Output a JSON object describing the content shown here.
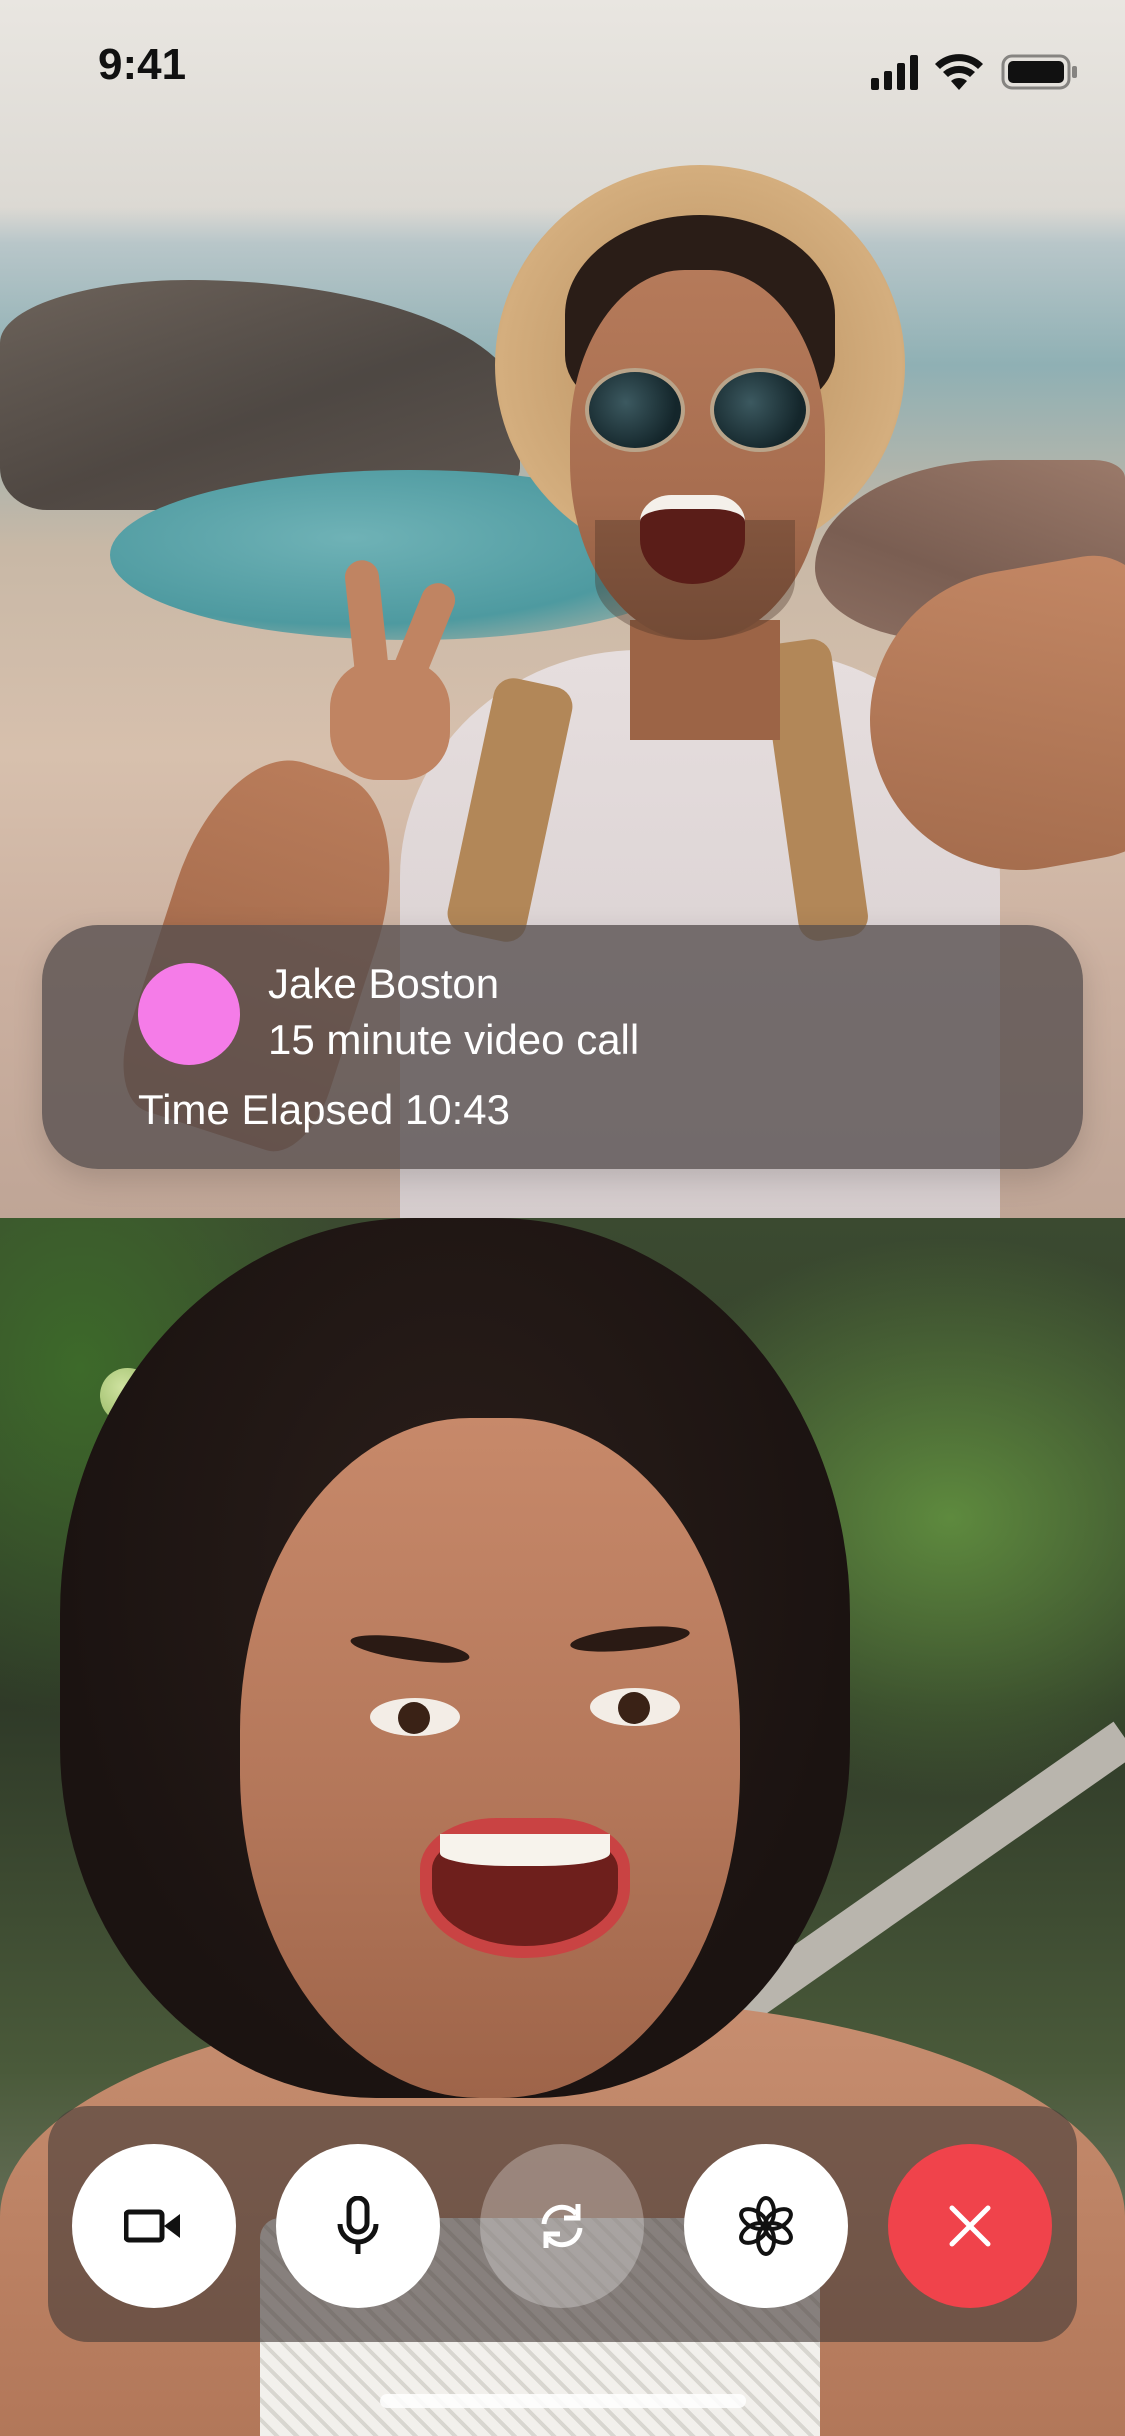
{
  "status_bar": {
    "time": "9:41",
    "icons": [
      "cellular-signal-icon",
      "wifi-icon",
      "battery-icon"
    ]
  },
  "call": {
    "caller_name": "Jake Boston",
    "call_type": "15 minute video call",
    "elapsed_text": "Time Elapsed 10:43",
    "avatar_color": "#f57ce8"
  },
  "controls": [
    {
      "name": "camera-toggle-button",
      "icon": "video-camera-icon"
    },
    {
      "name": "microphone-toggle-button",
      "icon": "microphone-icon"
    },
    {
      "name": "switch-camera-button",
      "icon": "rotate-camera-icon"
    },
    {
      "name": "effects-button",
      "icon": "flower-icon"
    },
    {
      "name": "end-call-button",
      "icon": "close-icon",
      "color": "#f0434b"
    }
  ]
}
